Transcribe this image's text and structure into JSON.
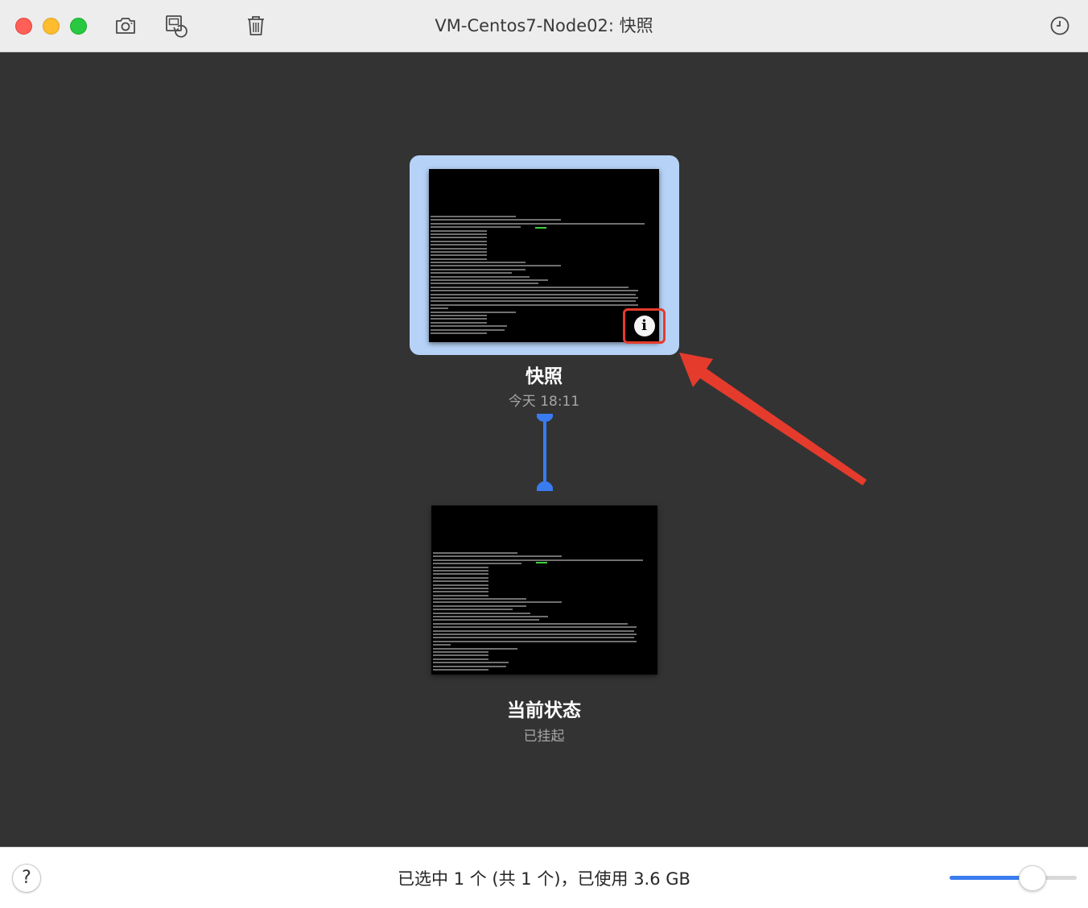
{
  "window": {
    "title": "VM-Centos7-Node02: 快照",
    "controls": {
      "close": "close",
      "minimize": "minimize",
      "maximize": "maximize"
    }
  },
  "toolbar": {
    "icons": [
      "camera-icon",
      "restore-snapshot-icon",
      "trash-icon",
      "clock-icon"
    ]
  },
  "snapshots": [
    {
      "name": "快照",
      "subtitle": "今天 18:11",
      "selected": true,
      "icon": "info-icon",
      "info_glyph": "i"
    },
    {
      "name": "当前状态",
      "subtitle": "已挂起",
      "selected": false
    }
  ],
  "footer": {
    "help_label": "?",
    "status": "已选中 1 个 (共 1 个)，已使用 3.6 GB",
    "zoom_level_fraction": 0.65
  },
  "colors": {
    "selection": "#b6d3f7",
    "connector": "#3a7cf0",
    "annotation": "#e53b2c",
    "canvas": "#333333"
  }
}
